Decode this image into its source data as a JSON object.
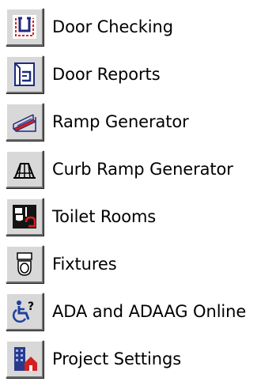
{
  "menu": {
    "items": [
      {
        "label": "Door Checking",
        "icon": "door-checking-icon"
      },
      {
        "label": "Door Reports",
        "icon": "door-reports-icon"
      },
      {
        "label": "Ramp Generator",
        "icon": "ramp-generator-icon"
      },
      {
        "label": "Curb Ramp Generator",
        "icon": "curb-ramp-icon"
      },
      {
        "label": "Toilet Rooms",
        "icon": "toilet-rooms-icon"
      },
      {
        "label": "Fixtures",
        "icon": "fixtures-icon"
      },
      {
        "label": "ADA and ADAAG Online",
        "icon": "ada-online-icon"
      },
      {
        "label": "Project Settings",
        "icon": "project-settings-icon"
      }
    ]
  },
  "colors": {
    "button_face": "#d8d8d8",
    "accent_red": "#d42020",
    "accent_blue": "#2a3a8a"
  }
}
